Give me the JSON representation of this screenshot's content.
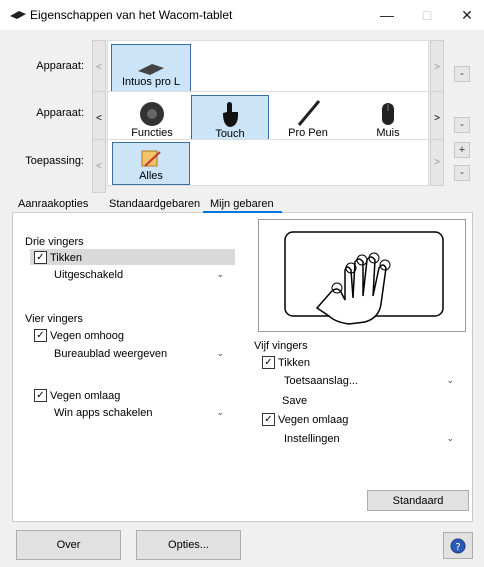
{
  "window": {
    "title": "Eigenschappen van het Wacom-tablet"
  },
  "rows": {
    "device_label": "Apparaat:",
    "device_item": "Intuos pro L",
    "tool_label": "Apparaat:",
    "tools": [
      "Functies",
      "Touch",
      "Pro Pen",
      "Muis"
    ],
    "app_label": "Toepassing:",
    "app_item": "Alles"
  },
  "tabs": [
    "Aanraakopties",
    "Standaardgebaren",
    "Mijn gebaren"
  ],
  "three": {
    "title": "Drie vingers",
    "tap_label": "Tikken",
    "tap_value": "Uitgeschakeld"
  },
  "four": {
    "title": "Vier vingers",
    "up_label": "Vegen omhoog",
    "up_value": "Bureaublad weergeven",
    "down_label": "Vegen omlaag",
    "down_value": "Win apps schakelen"
  },
  "five": {
    "title": "Vijf vingers",
    "tap_label": "Tikken",
    "tap_value": "Toetsaanslag...",
    "save_text": "Save",
    "down_label": "Vegen omlaag",
    "down_value": "Instellingen"
  },
  "buttons": {
    "default": "Standaard",
    "about": "Over",
    "options": "Opties..."
  },
  "colors": {
    "selection": "#cce4f7",
    "accent": "#0078d7"
  }
}
